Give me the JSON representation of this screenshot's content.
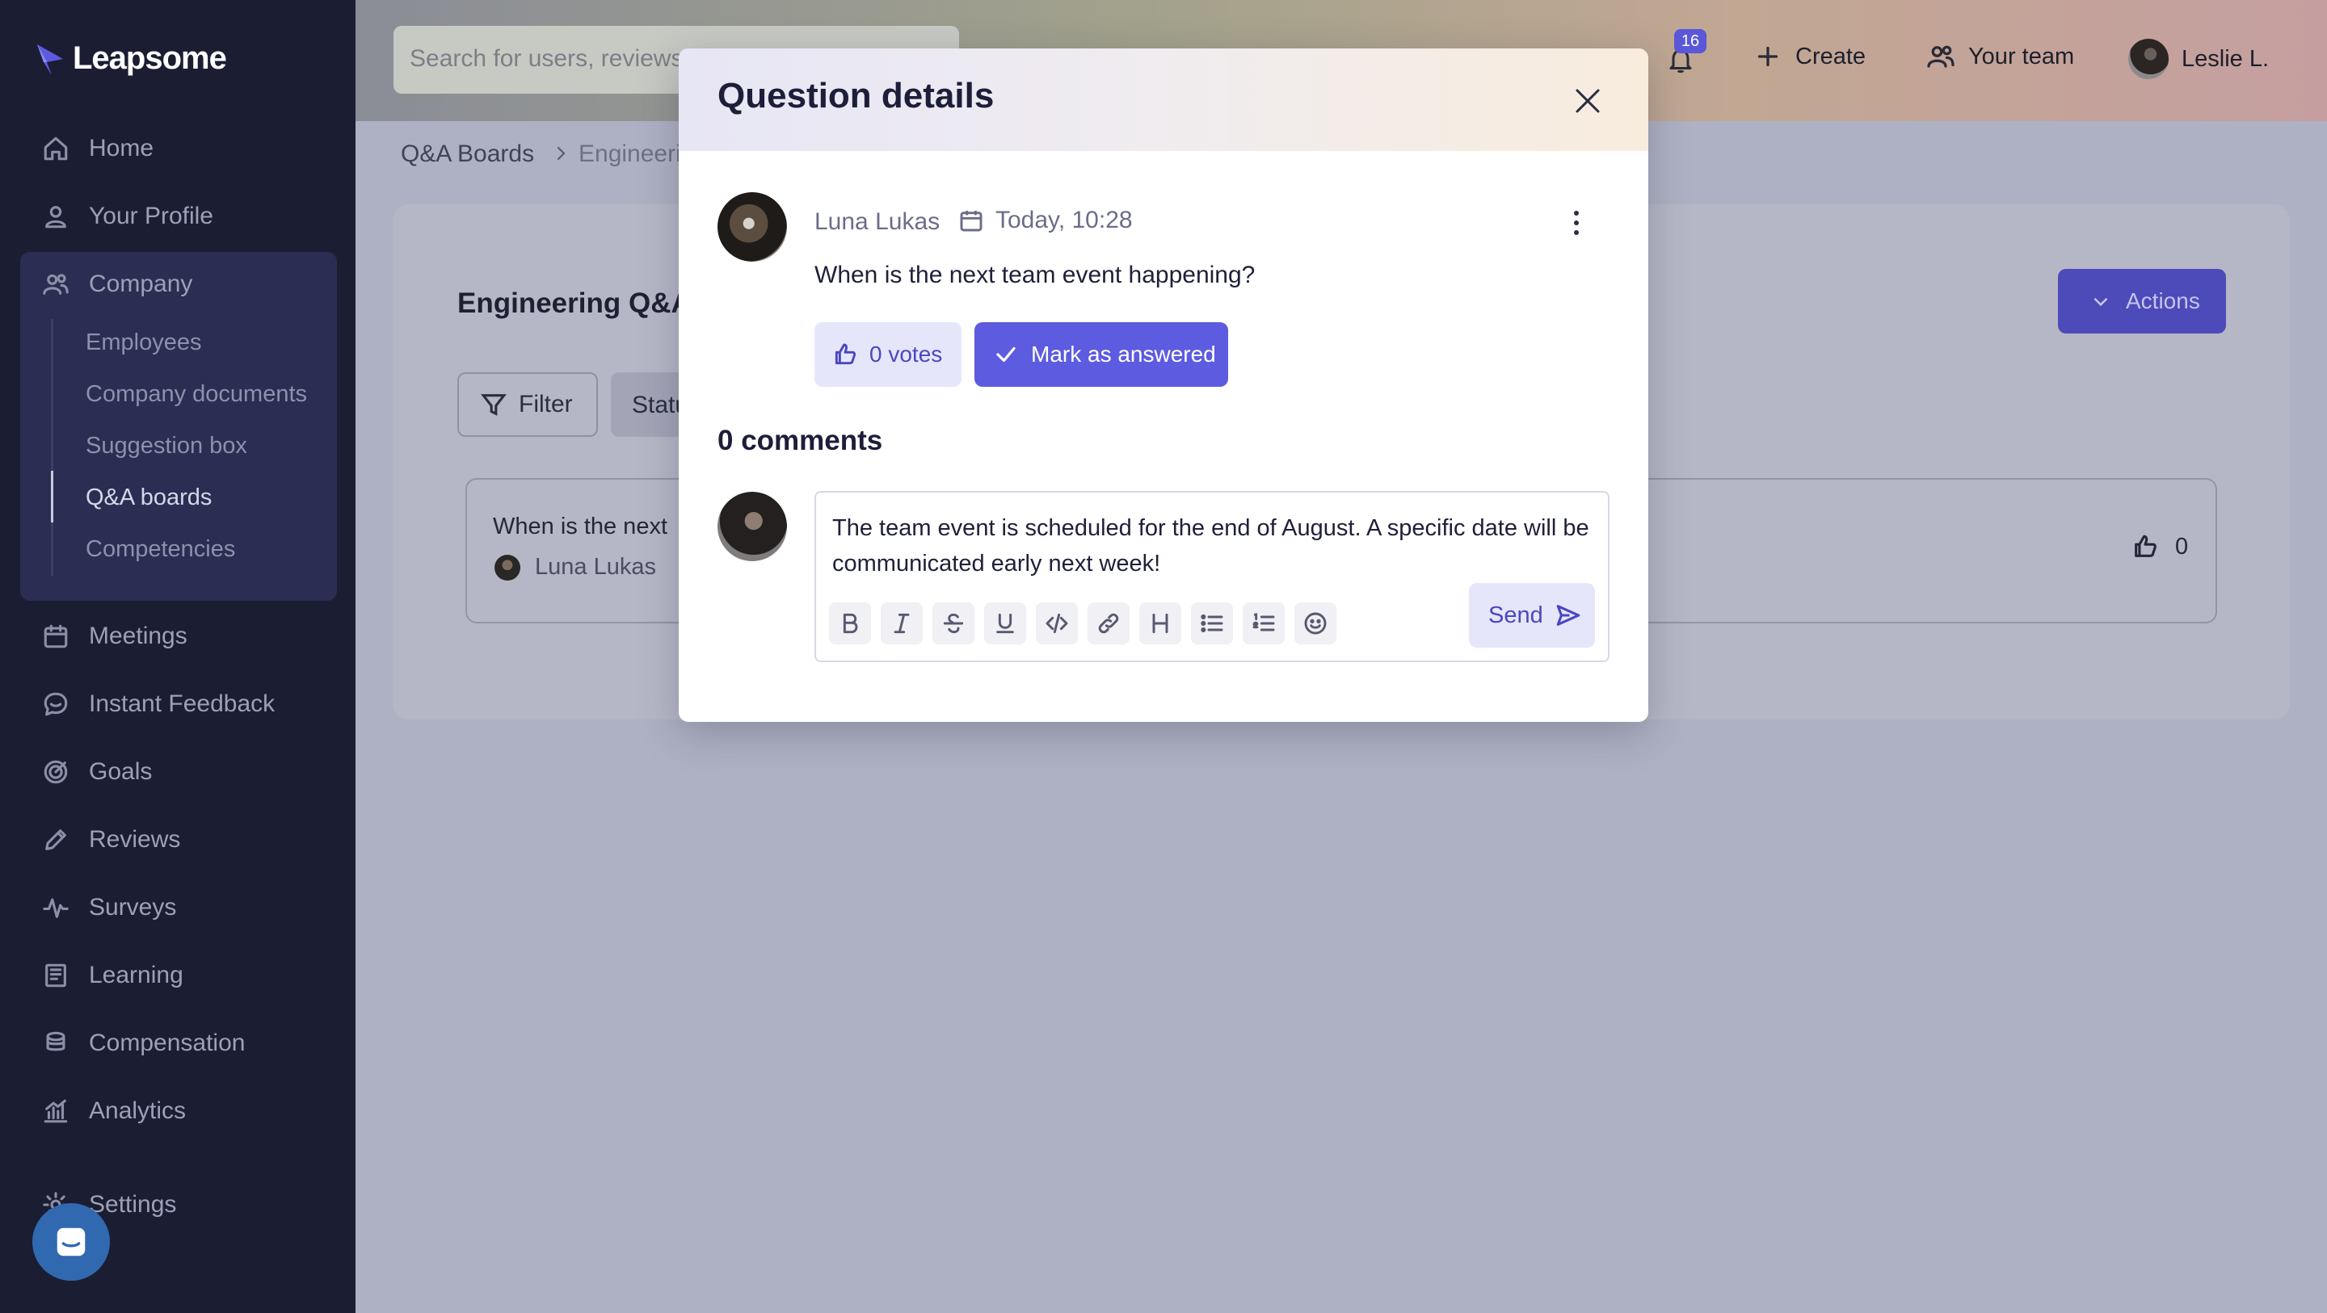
{
  "brand": {
    "name": "Leapsome"
  },
  "sidebar": {
    "items": [
      {
        "label": "Home",
        "icon": "home-icon"
      },
      {
        "label": "Your Profile",
        "icon": "user-icon"
      },
      {
        "label": "Company",
        "icon": "users-icon"
      },
      {
        "label": "Meetings",
        "icon": "calendar-icon"
      },
      {
        "label": "Instant Feedback",
        "icon": "chat-icon"
      },
      {
        "label": "Goals",
        "icon": "target-icon"
      },
      {
        "label": "Reviews",
        "icon": "pen-icon"
      },
      {
        "label": "Surveys",
        "icon": "pulse-icon"
      },
      {
        "label": "Learning",
        "icon": "book-icon"
      },
      {
        "label": "Compensation",
        "icon": "coins-icon"
      },
      {
        "label": "Analytics",
        "icon": "analytics-icon"
      },
      {
        "label": "Settings",
        "icon": "gear-icon"
      }
    ],
    "company_sub": [
      "Employees",
      "Company documents",
      "Suggestion box",
      "Q&A boards",
      "Competencies"
    ],
    "active_sub": "Q&A boards"
  },
  "topbar": {
    "search_placeholder": "Search for users, reviews",
    "notification_count": "16",
    "create_label": "Create",
    "your_team_label": "Your team",
    "user_name": "Leslie L."
  },
  "breadcrumb": [
    "Q&A Boards",
    "Engineeri"
  ],
  "board": {
    "title": "Engineering Q&A",
    "actions_label": "Actions",
    "filter_label": "Filter",
    "status_label": "Status",
    "question_preview": "When is the next",
    "question_author": "Luna Lukas",
    "question_votes": "0"
  },
  "modal": {
    "title": "Question details",
    "author": "Luna Lukas",
    "date": "Today, 10:28",
    "question": "When is the next team event happening?",
    "votes_label": "0 votes",
    "answer_label": "Mark as answered",
    "comments_title": "0 comments",
    "draft_comment": "The team event is scheduled for the end of August. A specific date will be communicated early next week!",
    "send_label": "Send"
  },
  "colors": {
    "sidebar_bg": "#1b1d33",
    "accent": "#5d5be0",
    "accent_soft": "#e6e6fb"
  }
}
